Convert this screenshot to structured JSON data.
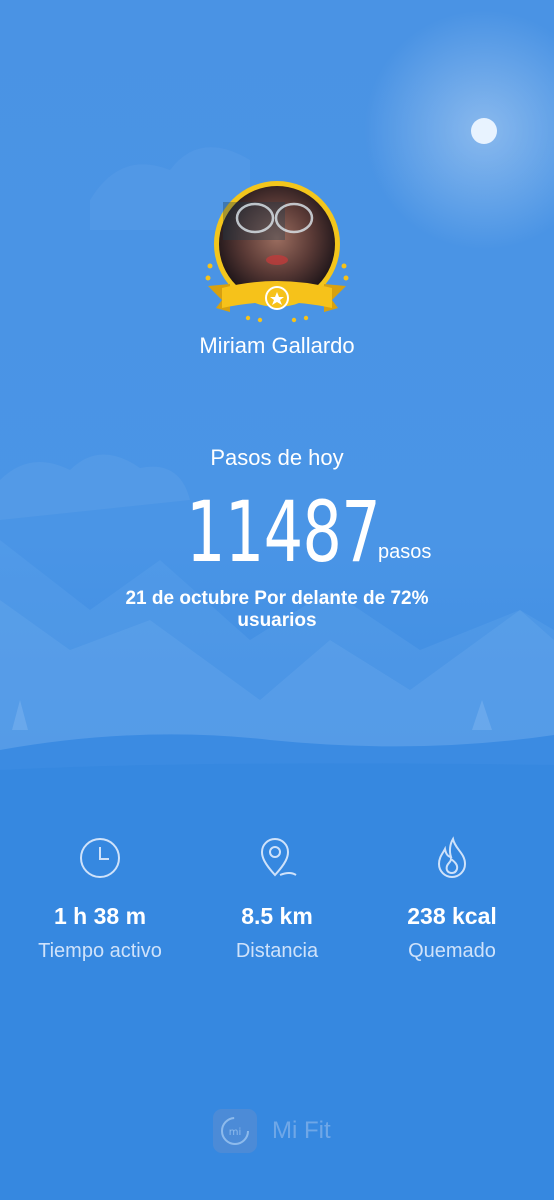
{
  "user": {
    "name": "Miriam Gallardo"
  },
  "today": {
    "label": "Pasos de hoy",
    "steps": "11487",
    "unit": "pasos",
    "rank_text": "21 de octubre Por delante de 72% usuarios"
  },
  "stats": [
    {
      "icon": "clock-icon",
      "value": "1 h 38 m",
      "label": "Tiempo activo"
    },
    {
      "icon": "location-pin-icon",
      "value": "8.5 km",
      "label": "Distancia"
    },
    {
      "icon": "flame-icon",
      "value": "238 kcal",
      "label": "Quemado"
    }
  ],
  "brand": {
    "name": "Mi Fit",
    "logo_text": "mi"
  },
  "colors": {
    "background": "#4a93e4",
    "badge_gold": "#f6c21a",
    "text": "#ffffff"
  }
}
